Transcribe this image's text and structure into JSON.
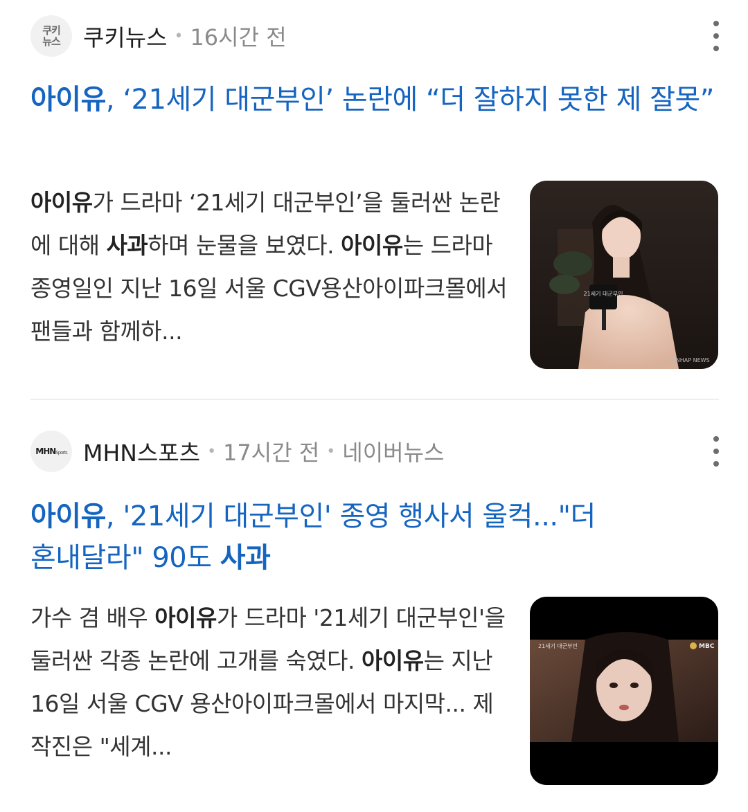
{
  "articles": [
    {
      "source": "쿠키뉴스",
      "logo_line1": "쿠키",
      "logo_line2": "뉴스",
      "time": "16시간 전",
      "headline_bold": "아이유",
      "headline_rest": ", ‘21세기 대군부인’ 논란에 “더 잘하지 못한 제 잘못”",
      "snippet": [
        {
          "t": "아이유",
          "b": true
        },
        {
          "t": "가 드라마 ‘21세기 대군부인’을 둘러싼 논란에 대해 ",
          "b": false
        },
        {
          "t": "사과",
          "b": true
        },
        {
          "t": "하며 눈물을 보였다. ",
          "b": false
        },
        {
          "t": "아이유",
          "b": true
        },
        {
          "t": "는 드라마 종영일인 지난 16일 서울 CGV용산아이파크몰에서 팬들과 함께하...",
          "b": false
        }
      ],
      "thumb_sign": "21세기 대군부인",
      "thumb_watermark": "YONHAP NEWS",
      "thumb_alt": "마이크를 든 아이유 사진"
    },
    {
      "source": "MHN스포츠",
      "logo_text": "MHN",
      "logo_small": "Sports",
      "time": "17시간 전",
      "platform": "네이버뉴스",
      "headline_bold": "아이유",
      "headline_rest": ", '21세기 대군부인' 종영 행사서 울컥...\"더 혼내달라\" 90도 ",
      "headline_bold2": "사과",
      "snippet": [
        {
          "t": "가수 겸 배우 ",
          "b": false
        },
        {
          "t": "아이유",
          "b": true
        },
        {
          "t": "가 드라마 '21세기 대군부인'을 둘러싼 각종 논란에 고개를 숙였다. ",
          "b": false
        },
        {
          "t": "아이유",
          "b": true
        },
        {
          "t": "는 지난 16일 서울 CGV 용산아이파크몰에서 마지막... 제작진은 \"세계...",
          "b": false
        }
      ],
      "thumb_caption": "21세기 대군부인",
      "thumb_badge": "MBC",
      "thumb_alt": "방송 화면 속 아이유"
    }
  ]
}
